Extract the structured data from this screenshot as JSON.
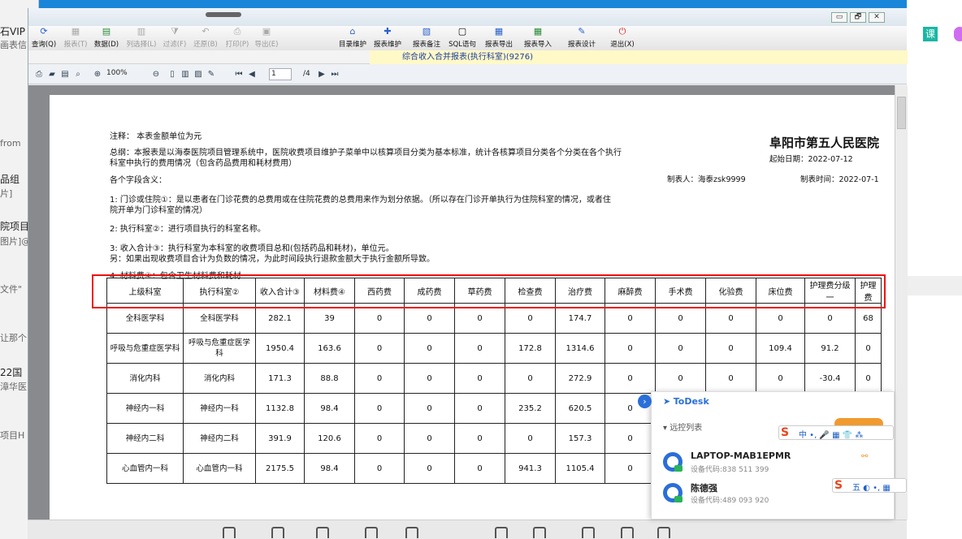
{
  "background_left": {
    "fragments": [
      "石VIP",
      "画表信",
      "from",
      "品组",
      "片]",
      "院项目",
      "图片]@",
      "文件\"",
      "让那个",
      "22国",
      "漳华医",
      "项目H"
    ]
  },
  "background_right": {
    "badge": "课"
  },
  "app": {
    "window_buttons": [
      "▭",
      "🗗",
      "✕"
    ],
    "toolbar": [
      {
        "label": "查询(Q)",
        "icon": "refresh-icon",
        "enabled": true
      },
      {
        "label": "报表(T)",
        "icon": "report-icon",
        "enabled": false
      },
      {
        "label": "数据(D)",
        "icon": "data-icon",
        "enabled": true
      },
      {
        "label": "列选择(L)",
        "icon": "columns-icon",
        "enabled": false
      },
      {
        "label": "过滤(F)",
        "icon": "filter-icon",
        "enabled": false
      },
      {
        "label": "还原(B)",
        "icon": "undo-icon",
        "enabled": false
      },
      {
        "label": "打印(P)",
        "icon": "print-icon",
        "enabled": false
      },
      {
        "label": "导出(E)",
        "icon": "export-icon",
        "enabled": false
      },
      {
        "label": "目录维护",
        "icon": "catalog-icon",
        "enabled": true
      },
      {
        "label": "报表维护",
        "icon": "plus-icon",
        "enabled": true
      },
      {
        "label": "报表备注",
        "icon": "note-icon",
        "enabled": true
      },
      {
        "label": "SQL语句",
        "icon": "sql-icon",
        "enabled": true
      },
      {
        "label": "报表导出",
        "icon": "report-export-icon",
        "enabled": true
      },
      {
        "label": "报表导入",
        "icon": "report-import-icon",
        "enabled": true
      },
      {
        "label": "报表设计",
        "icon": "design-icon",
        "enabled": true
      },
      {
        "label": "退出(X)",
        "icon": "power-icon",
        "enabled": true
      }
    ],
    "subtitle": "综合收入合并报表(执行科室)(9276)",
    "viewer": {
      "zoom": "100%",
      "page_current": "1",
      "page_total": "/4"
    }
  },
  "report": {
    "notes": [
      "注释：            本表金额单位为元",
      "总纲：本报表是以海泰医院项目管理系统中，医院收费项目维护子菜单中以核算项目分类为基本标准，统计各核算项目分类各个分类在各个执行",
      "科室中执行的费用情况（包含药品费用和耗材费用）",
      "各个字段含义：",
      "1: 门诊或住院①：是以患者在门诊花费的总费用或在住院花费的总费用来作为划分依据。（所以存在门诊开单执行为住院科室的情况，或者住",
      "院开单为门诊科室的情况）",
      "2: 执行科室②：进行项目执行的科室名称。",
      "3: 收入合计③：执行科室为本科室的收费项目总和(包括药品和耗材)，单位元。",
      "         另：如果出现收费项目合计为负数的情况，为此时间段执行退款金额大于执行金额所导致。",
      "4: 材料费④：包含卫生材料费和耗材"
    ],
    "hospital": "阜阳市第五人民医院",
    "start_date": "起始日期：2022-07-12",
    "maker": "制表人：海泰zsk9999",
    "make_time": "制表时间：2022-07-1",
    "columns": [
      "上级科室",
      "执行科室②",
      "收入合计③",
      "材料费④",
      "西药费",
      "成药费",
      "草药费",
      "检查费",
      "治疗费",
      "麻醉费",
      "手术费",
      "化验费",
      "床位费",
      "护理费分级一",
      "护理费"
    ],
    "rows": [
      [
        "全科医学科",
        "全科医学科",
        "282.1",
        "39",
        "0",
        "0",
        "0",
        "0",
        "174.7",
        "0",
        "0",
        "0",
        "0",
        "0",
        "68"
      ],
      [
        "呼吸与危重症医学科",
        "呼吸与危重症医学科",
        "1950.4",
        "163.6",
        "0",
        "0",
        "0",
        "172.8",
        "1314.6",
        "0",
        "0",
        "0",
        "109.4",
        "91.2",
        "0"
      ],
      [
        "消化内科",
        "消化内科",
        "171.3",
        "88.8",
        "0",
        "0",
        "0",
        "0",
        "272.9",
        "0",
        "0",
        "0",
        "0",
        "-30.4",
        "0"
      ],
      [
        "神经内一科",
        "神经内一科",
        "1132.8",
        "98.4",
        "0",
        "0",
        "0",
        "235.2",
        "620.5",
        "0",
        "",
        "",
        "",
        "",
        ""
      ],
      [
        "神经内二科",
        "神经内二科",
        "391.9",
        "120.6",
        "0",
        "0",
        "0",
        "0",
        "157.3",
        "0",
        "",
        "",
        "",
        "",
        ""
      ],
      [
        "心血管内一科",
        "心血管内一科",
        "2175.5",
        "98.4",
        "0",
        "0",
        "0",
        "941.3",
        "1105.4",
        "0",
        "",
        "",
        "",
        "",
        ""
      ]
    ]
  },
  "todesk": {
    "title": "ToDesk",
    "section": "▾ 远控列表",
    "devices": [
      {
        "name": "LAPTOP-MAB1EPMR",
        "code": "设备代码:838 511 399"
      },
      {
        "name": "陈德强",
        "code": "设备代码:489 093 920"
      }
    ],
    "ime1": "中 •, 🎤 ▦ 👕 ⁂",
    "ime2": "五 ◐ •, ▦"
  }
}
